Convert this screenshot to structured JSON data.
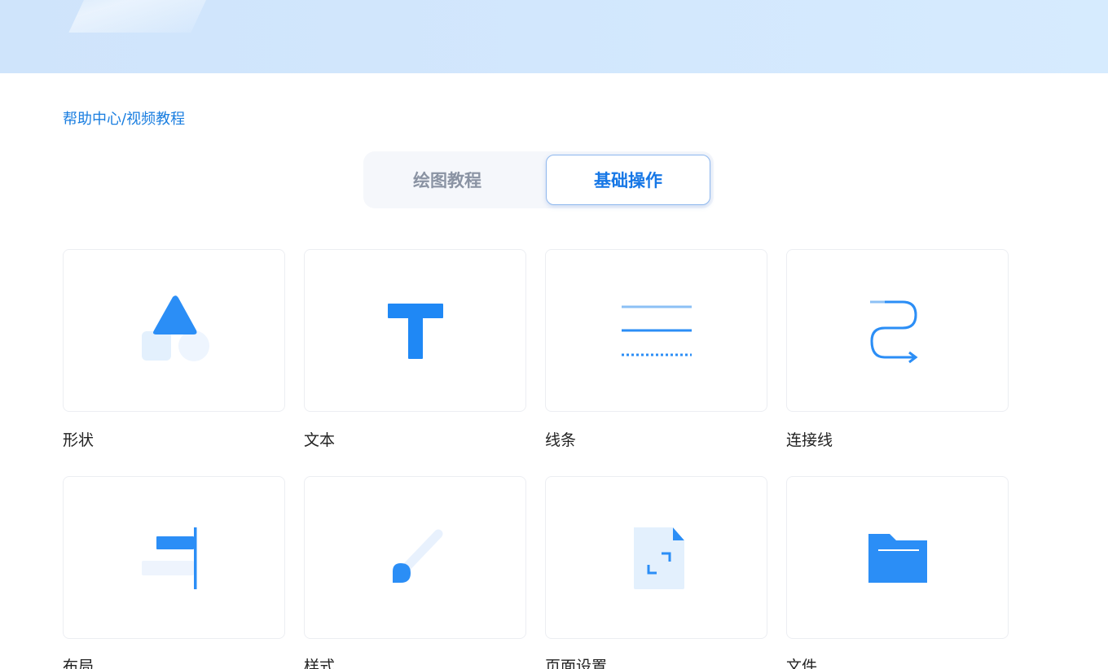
{
  "breadcrumb": "帮助中心/视频教程",
  "tabs": [
    {
      "label": "绘图教程",
      "active": false
    },
    {
      "label": "基础操作",
      "active": true
    }
  ],
  "colors": {
    "accent": "#1677e6",
    "link": "#1a7ee0",
    "icon_blue": "#2b8ef6",
    "icon_light": "#e3f0fd"
  },
  "items": [
    {
      "label": "形状",
      "icon": "shapes-icon"
    },
    {
      "label": "文本",
      "icon": "text-icon"
    },
    {
      "label": "线条",
      "icon": "lines-icon"
    },
    {
      "label": "连接线",
      "icon": "connector-icon"
    },
    {
      "label": "布局",
      "icon": "align-layout-icon"
    },
    {
      "label": "样式",
      "icon": "brush-icon"
    },
    {
      "label": "页面设置",
      "icon": "page-settings-icon"
    },
    {
      "label": "文件",
      "icon": "folder-icon"
    }
  ]
}
